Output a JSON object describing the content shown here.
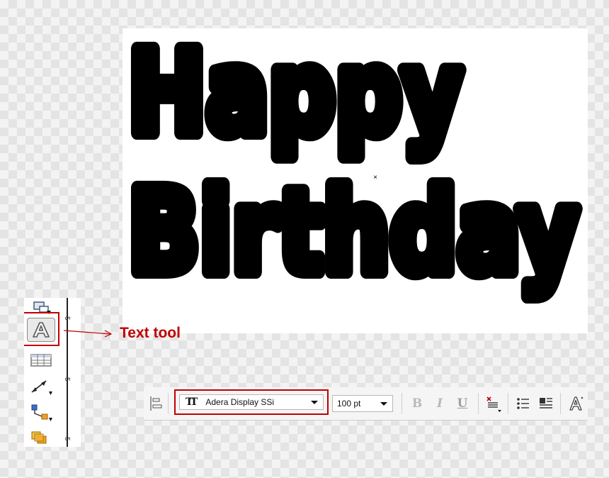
{
  "canvas": {
    "headline_line1": "Happy",
    "headline_line2": "Birthday",
    "center_marker": "×"
  },
  "toolbox": {
    "ruler_ticks": [
      "5",
      "5",
      "5"
    ],
    "tools": [
      {
        "name": "crop-tool-icon"
      },
      {
        "name": "text-tool-icon",
        "selected": true
      },
      {
        "name": "table-tool-icon"
      },
      {
        "name": "dimension-tool-icon"
      },
      {
        "name": "connector-tool-icon"
      },
      {
        "name": "blend-tool-icon"
      }
    ]
  },
  "callout": {
    "label": "Text tool",
    "color": "#c00000"
  },
  "property_bar": {
    "font_list_glyph": "TT",
    "font_family_value": "Adera Display SSi",
    "font_size_value": "100 pt",
    "bold_label": "B",
    "italic_label": "I",
    "underline_label": "U",
    "character_formatting_glyph": "A"
  },
  "colors": {
    "highlight": "#c00000",
    "text_fill": "#000000",
    "canvas": "#ffffff"
  }
}
